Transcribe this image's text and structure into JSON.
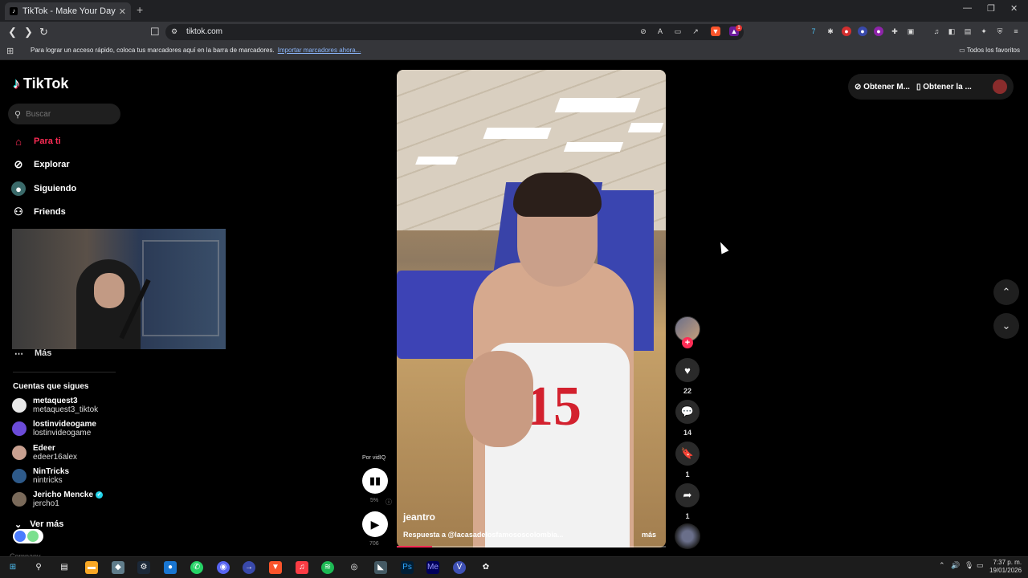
{
  "browser": {
    "tab_title": "TikTok - Make Your Day",
    "tab_close": "✕",
    "new_tab": "+",
    "url": "tiktok.com",
    "bookmarks_message": "Para lograr un acceso rápido, coloca tus marcadores aquí en la barra de marcadores.",
    "import_link": "Importar marcadores ahora...",
    "all_favorites": "Todos los favoritos",
    "badge_count": "1"
  },
  "sidebar": {
    "logo": "TikTok",
    "search_placeholder": "Buscar",
    "nav": [
      {
        "label": "Para ti",
        "icon": "home-icon"
      },
      {
        "label": "Explorar",
        "icon": "compass-icon"
      },
      {
        "label": "Siguiendo",
        "icon": "following-icon"
      },
      {
        "label": "Friends",
        "icon": "friends-icon"
      }
    ],
    "more_label": "Más",
    "following_title": "Cuentas que sigues",
    "accounts": [
      {
        "name": "metaquest3",
        "username": "metaquest3_tiktok",
        "color": "#e8e8e8"
      },
      {
        "name": "lostinvideogame",
        "username": "lostinvideogame",
        "color": "#6b4bd8"
      },
      {
        "name": "Edeer",
        "username": "edeer16alex",
        "color": "#c8a090"
      },
      {
        "name": "NinTricks",
        "username": "nintricks",
        "color": "#2e5a8a"
      },
      {
        "name": "Jericho Mencke",
        "username": "jercho1",
        "color": "#7a6a5a",
        "verified": true
      }
    ],
    "see_more": "Ver más",
    "company": "Company"
  },
  "video": {
    "author": "jeantro",
    "description": "Respuesta a @lacasadelosfamososcolombia...",
    "more": "más",
    "jersey_number": "15",
    "progress": 0.13
  },
  "actions": {
    "likes": "22",
    "comments": "14",
    "saves": "1",
    "shares": "1"
  },
  "vidiq": {
    "label": "Por vidIQ",
    "percent": "5%",
    "views": "706"
  },
  "topbar": {
    "get_app": "Obtener M...",
    "get_desktop": "Obtener la ..."
  },
  "taskbar": {
    "time": "7:37 p. m.",
    "date": "19/01/2026"
  },
  "colors": {
    "accent": "#fe2c55",
    "background": "#000000",
    "verified": "#20d5ec"
  }
}
